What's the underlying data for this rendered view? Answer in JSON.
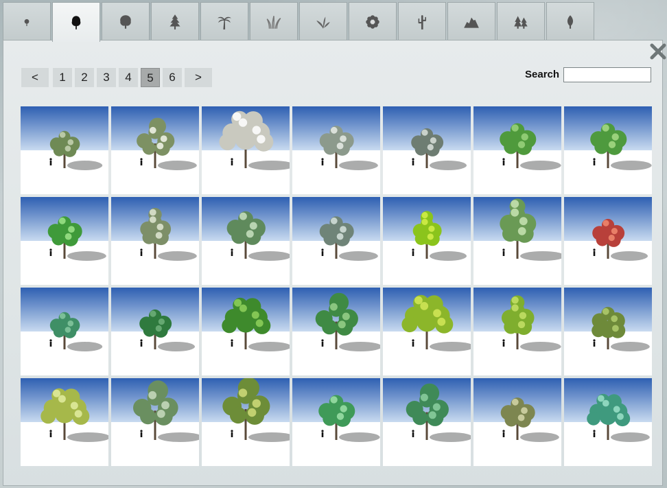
{
  "tabs": [
    {
      "icon": "small-tree-icon"
    },
    {
      "icon": "deciduous-tree-icon",
      "active": true
    },
    {
      "icon": "bushy-tree-icon"
    },
    {
      "icon": "conifer-tree-icon"
    },
    {
      "icon": "palm-tree-icon"
    },
    {
      "icon": "grass-icon"
    },
    {
      "icon": "plant-leaves-icon"
    },
    {
      "icon": "flower-icon"
    },
    {
      "icon": "cactus-icon"
    },
    {
      "icon": "rock-icon"
    },
    {
      "icon": "conifer-group-icon"
    },
    {
      "icon": "leaf-icon"
    }
  ],
  "pagination": {
    "prev": "<",
    "next": ">",
    "pages": [
      "1",
      "2",
      "3",
      "4",
      "5",
      "6"
    ],
    "current": "5"
  },
  "search": {
    "label": "Search",
    "value": ""
  },
  "close_icon": "close-icon",
  "colors": {
    "sky_top": "#2e5fb2",
    "sky_bottom": "#c9dbf0",
    "ground": "#ffffff",
    "active_page": "#a7aaaa"
  },
  "thumbnails": [
    {
      "foliage": "#6f8a55",
      "highlight": "#c7d4b4",
      "size": 0.7,
      "shape": "round"
    },
    {
      "foliage": "#7d9163",
      "highlight": "#f2f4ea",
      "size": 0.8,
      "shape": "sparse"
    },
    {
      "foliage": "#c9c9bf",
      "highlight": "#ffffff",
      "size": 1.0,
      "shape": "wide"
    },
    {
      "foliage": "#8c9a8c",
      "highlight": "#e8ece6",
      "size": 0.8,
      "shape": "round"
    },
    {
      "foliage": "#6e7d72",
      "highlight": "#d9dfd9",
      "size": 0.75,
      "shape": "round"
    },
    {
      "foliage": "#4f9a3c",
      "highlight": "#9ad47c",
      "size": 0.85,
      "shape": "round"
    },
    {
      "foliage": "#4e9a3e",
      "highlight": "#a8da86",
      "size": 0.85,
      "shape": "round"
    },
    {
      "foliage": "#3f9a3a",
      "highlight": "#9ee48a",
      "size": 0.8,
      "shape": "round"
    },
    {
      "foliage": "#7d8f68",
      "highlight": "#e0e8d4",
      "size": 0.8,
      "shape": "tall"
    },
    {
      "foliage": "#5f8a5c",
      "highlight": "#c8e0c0",
      "size": 0.9,
      "shape": "round"
    },
    {
      "foliage": "#6f8478",
      "highlight": "#d6e2dc",
      "size": 0.8,
      "shape": "round"
    },
    {
      "foliage": "#8bc41c",
      "highlight": "#d4f04a",
      "size": 0.75,
      "shape": "tall"
    },
    {
      "foliage": "#6a9a55",
      "highlight": "#c8e4b4",
      "size": 0.95,
      "shape": "tall"
    },
    {
      "foliage": "#b8403a",
      "highlight": "#f08a70",
      "size": 0.75,
      "shape": "round"
    },
    {
      "foliage": "#3f8f66",
      "highlight": "#86c8a0",
      "size": 0.7,
      "shape": "round"
    },
    {
      "foliage": "#2f7a3e",
      "highlight": "#6eb07a",
      "size": 0.75,
      "shape": "round"
    },
    {
      "foliage": "#3e8a2c",
      "highlight": "#8fd05c",
      "size": 0.9,
      "shape": "wide"
    },
    {
      "foliage": "#3f8a44",
      "highlight": "#98d08a",
      "size": 0.9,
      "shape": "sparse"
    },
    {
      "foliage": "#8cb62a",
      "highlight": "#d2e858",
      "size": 0.95,
      "shape": "wide"
    },
    {
      "foliage": "#7fae2e",
      "highlight": "#c4e066",
      "size": 0.85,
      "shape": "tall"
    },
    {
      "foliage": "#6e8a3a",
      "highlight": "#b2cc6e",
      "size": 0.8,
      "shape": "weeping"
    },
    {
      "foliage": "#a6b84a",
      "highlight": "#e2eca0",
      "size": 0.9,
      "shape": "wide"
    },
    {
      "foliage": "#6a8f60",
      "highlight": "#c8dcc0",
      "size": 0.95,
      "shape": "sparse"
    },
    {
      "foliage": "#6d8d38",
      "highlight": "#d0dc7a",
      "size": 1.0,
      "shape": "sparse"
    },
    {
      "foliage": "#3f9a58",
      "highlight": "#9ee0a8",
      "size": 0.85,
      "shape": "round"
    },
    {
      "foliage": "#3f8a58",
      "highlight": "#8ccfa0",
      "size": 0.9,
      "shape": "sparse"
    },
    {
      "foliage": "#7d8650",
      "highlight": "#d4d6a8",
      "size": 0.8,
      "shape": "round"
    },
    {
      "foliage": "#3f9a7e",
      "highlight": "#9be0c8",
      "size": 0.8,
      "shape": "wide"
    }
  ]
}
